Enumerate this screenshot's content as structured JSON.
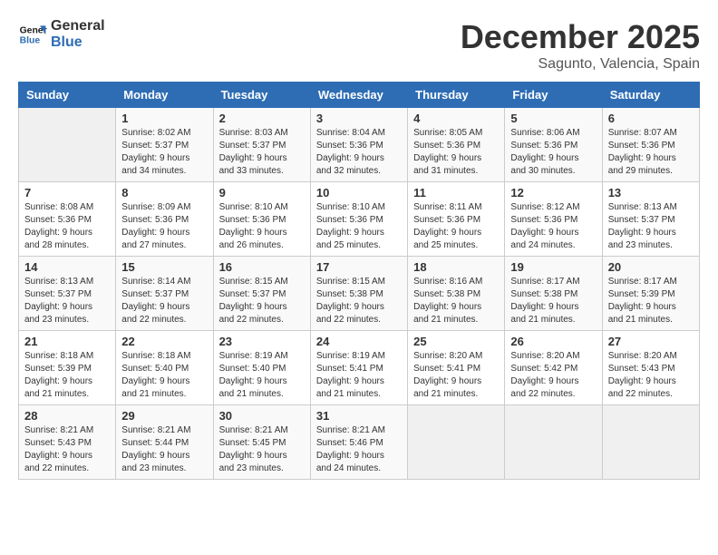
{
  "logo": {
    "line1": "General",
    "line2": "Blue"
  },
  "title": "December 2025",
  "location": "Sagunto, Valencia, Spain",
  "days_header": [
    "Sunday",
    "Monday",
    "Tuesday",
    "Wednesday",
    "Thursday",
    "Friday",
    "Saturday"
  ],
  "weeks": [
    [
      {
        "day": "",
        "sunrise": "",
        "sunset": "",
        "daylight": ""
      },
      {
        "day": "1",
        "sunrise": "8:02 AM",
        "sunset": "5:37 PM",
        "daylight": "9 hours and 34 minutes."
      },
      {
        "day": "2",
        "sunrise": "8:03 AM",
        "sunset": "5:37 PM",
        "daylight": "9 hours and 33 minutes."
      },
      {
        "day": "3",
        "sunrise": "8:04 AM",
        "sunset": "5:36 PM",
        "daylight": "9 hours and 32 minutes."
      },
      {
        "day": "4",
        "sunrise": "8:05 AM",
        "sunset": "5:36 PM",
        "daylight": "9 hours and 31 minutes."
      },
      {
        "day": "5",
        "sunrise": "8:06 AM",
        "sunset": "5:36 PM",
        "daylight": "9 hours and 30 minutes."
      },
      {
        "day": "6",
        "sunrise": "8:07 AM",
        "sunset": "5:36 PM",
        "daylight": "9 hours and 29 minutes."
      }
    ],
    [
      {
        "day": "7",
        "sunrise": "8:08 AM",
        "sunset": "5:36 PM",
        "daylight": "9 hours and 28 minutes."
      },
      {
        "day": "8",
        "sunrise": "8:09 AM",
        "sunset": "5:36 PM",
        "daylight": "9 hours and 27 minutes."
      },
      {
        "day": "9",
        "sunrise": "8:10 AM",
        "sunset": "5:36 PM",
        "daylight": "9 hours and 26 minutes."
      },
      {
        "day": "10",
        "sunrise": "8:10 AM",
        "sunset": "5:36 PM",
        "daylight": "9 hours and 25 minutes."
      },
      {
        "day": "11",
        "sunrise": "8:11 AM",
        "sunset": "5:36 PM",
        "daylight": "9 hours and 25 minutes."
      },
      {
        "day": "12",
        "sunrise": "8:12 AM",
        "sunset": "5:36 PM",
        "daylight": "9 hours and 24 minutes."
      },
      {
        "day": "13",
        "sunrise": "8:13 AM",
        "sunset": "5:37 PM",
        "daylight": "9 hours and 23 minutes."
      }
    ],
    [
      {
        "day": "14",
        "sunrise": "8:13 AM",
        "sunset": "5:37 PM",
        "daylight": "9 hours and 23 minutes."
      },
      {
        "day": "15",
        "sunrise": "8:14 AM",
        "sunset": "5:37 PM",
        "daylight": "9 hours and 22 minutes."
      },
      {
        "day": "16",
        "sunrise": "8:15 AM",
        "sunset": "5:37 PM",
        "daylight": "9 hours and 22 minutes."
      },
      {
        "day": "17",
        "sunrise": "8:15 AM",
        "sunset": "5:38 PM",
        "daylight": "9 hours and 22 minutes."
      },
      {
        "day": "18",
        "sunrise": "8:16 AM",
        "sunset": "5:38 PM",
        "daylight": "9 hours and 21 minutes."
      },
      {
        "day": "19",
        "sunrise": "8:17 AM",
        "sunset": "5:38 PM",
        "daylight": "9 hours and 21 minutes."
      },
      {
        "day": "20",
        "sunrise": "8:17 AM",
        "sunset": "5:39 PM",
        "daylight": "9 hours and 21 minutes."
      }
    ],
    [
      {
        "day": "21",
        "sunrise": "8:18 AM",
        "sunset": "5:39 PM",
        "daylight": "9 hours and 21 minutes."
      },
      {
        "day": "22",
        "sunrise": "8:18 AM",
        "sunset": "5:40 PM",
        "daylight": "9 hours and 21 minutes."
      },
      {
        "day": "23",
        "sunrise": "8:19 AM",
        "sunset": "5:40 PM",
        "daylight": "9 hours and 21 minutes."
      },
      {
        "day": "24",
        "sunrise": "8:19 AM",
        "sunset": "5:41 PM",
        "daylight": "9 hours and 21 minutes."
      },
      {
        "day": "25",
        "sunrise": "8:20 AM",
        "sunset": "5:41 PM",
        "daylight": "9 hours and 21 minutes."
      },
      {
        "day": "26",
        "sunrise": "8:20 AM",
        "sunset": "5:42 PM",
        "daylight": "9 hours and 22 minutes."
      },
      {
        "day": "27",
        "sunrise": "8:20 AM",
        "sunset": "5:43 PM",
        "daylight": "9 hours and 22 minutes."
      }
    ],
    [
      {
        "day": "28",
        "sunrise": "8:21 AM",
        "sunset": "5:43 PM",
        "daylight": "9 hours and 22 minutes."
      },
      {
        "day": "29",
        "sunrise": "8:21 AM",
        "sunset": "5:44 PM",
        "daylight": "9 hours and 23 minutes."
      },
      {
        "day": "30",
        "sunrise": "8:21 AM",
        "sunset": "5:45 PM",
        "daylight": "9 hours and 23 minutes."
      },
      {
        "day": "31",
        "sunrise": "8:21 AM",
        "sunset": "5:46 PM",
        "daylight": "9 hours and 24 minutes."
      },
      {
        "day": "",
        "sunrise": "",
        "sunset": "",
        "daylight": ""
      },
      {
        "day": "",
        "sunrise": "",
        "sunset": "",
        "daylight": ""
      },
      {
        "day": "",
        "sunrise": "",
        "sunset": "",
        "daylight": ""
      }
    ]
  ]
}
